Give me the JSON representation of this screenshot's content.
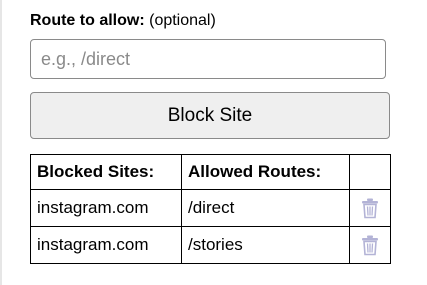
{
  "route": {
    "label_bold": "Route to allow:",
    "label_suffix": "(optional)",
    "input_value": "",
    "input_placeholder": "e.g., /direct"
  },
  "block_button_label": "Block Site",
  "table": {
    "headers": [
      "Blocked Sites:",
      "Allowed Routes:",
      ""
    ],
    "rows": [
      {
        "site": "instagram.com",
        "route": "/direct",
        "action_icon": "trash-icon"
      },
      {
        "site": "instagram.com",
        "route": "/stories",
        "action_icon": "trash-icon"
      }
    ]
  },
  "colors": {
    "icon": "#b3b3d6"
  }
}
